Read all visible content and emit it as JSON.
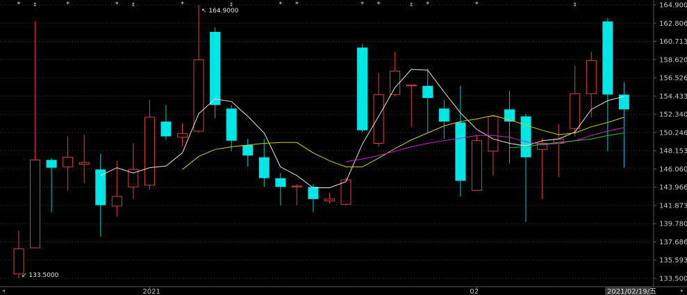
{
  "chart_data": {
    "type": "candlestick",
    "yticks": [
      "164.9000",
      "162.8067",
      "160.7133",
      "158.6200",
      "156.5267",
      "154.4333",
      "152.3400",
      "150.2467",
      "148.1533",
      "146.0600",
      "143.9667",
      "141.8733",
      "139.7800",
      "137.6867",
      "135.5933",
      "133.5000"
    ],
    "ylim": [
      133.5,
      164.9
    ],
    "x_labels": [
      {
        "index": 8,
        "text": "2021"
      },
      {
        "index": 28,
        "text": "02"
      }
    ],
    "cursor_date": "2021/02/19/五",
    "annotations": [
      {
        "text": "↖ 164.9000",
        "index": 11,
        "value": 164.9
      },
      {
        "text": "↙ 133.5000",
        "index": 0,
        "value": 133.5
      }
    ],
    "markers": [
      {
        "index": 0,
        "symbol": "*"
      },
      {
        "index": 1,
        "symbol": "⇕"
      },
      {
        "index": 3,
        "symbol": "*"
      },
      {
        "index": 6,
        "symbol": "*"
      },
      {
        "index": 7,
        "symbol": "⇕"
      },
      {
        "index": 10,
        "symbol": "*"
      },
      {
        "index": 13,
        "symbol": "⇕"
      },
      {
        "index": 16,
        "symbol": "*"
      },
      {
        "index": 17,
        "symbol": "*"
      },
      {
        "index": 21,
        "symbol": "*"
      },
      {
        "index": 22,
        "symbol": "*"
      },
      {
        "index": 24,
        "symbol": "⇕"
      },
      {
        "index": 25,
        "symbol": "*"
      },
      {
        "index": 28,
        "symbol": "*"
      },
      {
        "index": 34,
        "symbol": "⇕"
      }
    ],
    "candles": [
      {
        "o": 134.0,
        "h": 139.0,
        "l": 133.5,
        "c": 136.9
      },
      {
        "o": 137.0,
        "h": 163.0,
        "l": 137.0,
        "c": 147.1
      },
      {
        "o": 147.1,
        "h": 147.3,
        "l": 141.1,
        "c": 146.2
      },
      {
        "o": 146.3,
        "h": 149.8,
        "l": 143.6,
        "c": 147.4
      },
      {
        "o": 146.6,
        "h": 150.0,
        "l": 144.4,
        "c": 146.8
      },
      {
        "o": 146.0,
        "h": 147.8,
        "l": 138.3,
        "c": 141.9
      },
      {
        "o": 141.8,
        "h": 147.0,
        "l": 140.6,
        "c": 142.9
      },
      {
        "o": 144.0,
        "h": 149.0,
        "l": 142.6,
        "c": 146.0
      },
      {
        "o": 144.2,
        "h": 154.0,
        "l": 143.7,
        "c": 152.0
      },
      {
        "o": 151.5,
        "h": 153.4,
        "l": 149.4,
        "c": 149.8
      },
      {
        "o": 149.7,
        "h": 151.3,
        "l": 148.7,
        "c": 150.1
      },
      {
        "o": 150.4,
        "h": 164.9,
        "l": 150.2,
        "c": 158.6
      },
      {
        "o": 161.8,
        "h": 162.3,
        "l": 151.9,
        "c": 153.4
      },
      {
        "o": 153.0,
        "h": 153.4,
        "l": 148.1,
        "c": 149.3
      },
      {
        "o": 148.8,
        "h": 149.5,
        "l": 146.3,
        "c": 147.6
      },
      {
        "o": 147.4,
        "h": 149.5,
        "l": 144.0,
        "c": 145.0
      },
      {
        "o": 145.0,
        "h": 145.6,
        "l": 141.9,
        "c": 144.0
      },
      {
        "o": 144.0,
        "h": 144.3,
        "l": 141.9,
        "c": 144.1
      },
      {
        "o": 144.0,
        "h": 144.3,
        "l": 141.1,
        "c": 142.6
      },
      {
        "o": 142.4,
        "h": 143.3,
        "l": 142.1,
        "c": 142.6
      },
      {
        "o": 142.0,
        "h": 145.1,
        "l": 141.9,
        "c": 144.8
      },
      {
        "o": 160.0,
        "h": 160.4,
        "l": 150.3,
        "c": 150.5
      },
      {
        "o": 149.0,
        "h": 157.1,
        "l": 148.6,
        "c": 154.6
      },
      {
        "o": 154.6,
        "h": 159.5,
        "l": 154.4,
        "c": 157.3
      },
      {
        "o": 155.6,
        "h": 155.7,
        "l": 150.9,
        "c": 155.7
      },
      {
        "o": 155.6,
        "h": 157.6,
        "l": 150.2,
        "c": 154.2
      },
      {
        "o": 153.0,
        "h": 154.0,
        "l": 149.5,
        "c": 151.5
      },
      {
        "o": 151.4,
        "h": 155.6,
        "l": 142.9,
        "c": 144.7
      },
      {
        "o": 143.6,
        "h": 150.0,
        "l": 143.6,
        "c": 149.3
      },
      {
        "o": 148.1,
        "h": 152.2,
        "l": 145.3,
        "c": 152.1
      },
      {
        "o": 152.9,
        "h": 155.0,
        "l": 146.7,
        "c": 151.5
      },
      {
        "o": 152.1,
        "h": 152.4,
        "l": 140.0,
        "c": 147.4
      },
      {
        "o": 148.3,
        "h": 149.6,
        "l": 142.6,
        "c": 149.0
      },
      {
        "o": 149.0,
        "h": 151.2,
        "l": 145.1,
        "c": 149.5
      },
      {
        "o": 150.7,
        "h": 157.9,
        "l": 149.8,
        "c": 154.7
      },
      {
        "o": 154.7,
        "h": 159.5,
        "l": 152.0,
        "c": 158.5
      },
      {
        "o": 163.0,
        "h": 163.4,
        "l": 148.1,
        "c": 154.6
      },
      {
        "o": 154.6,
        "h": 156.0,
        "l": 146.2,
        "c": 152.9
      }
    ],
    "series": [
      {
        "color": "#e8e8e8",
        "values": [
          null,
          null,
          null,
          null,
          null,
          145.3,
          146.2,
          145.6,
          146.2,
          146.4,
          147.9,
          152.4,
          154.1,
          153.8,
          152.1,
          150.2,
          146.3,
          145.3,
          143.9,
          143.9,
          144.6,
          148.9,
          152.1,
          155.4,
          157.5,
          157.4,
          154.9,
          152.5,
          150.6,
          149.5,
          149.0,
          148.7,
          149.3,
          149.5,
          150.3,
          152.9,
          153.9,
          154.4
        ]
      },
      {
        "color": "#d4d400",
        "values": [
          null,
          null,
          null,
          null,
          null,
          null,
          null,
          null,
          null,
          null,
          146.0,
          147.5,
          148.3,
          148.6,
          148.8,
          149.0,
          149.1,
          149.1,
          147.9,
          147.0,
          146.3,
          146.3,
          147.3,
          148.4,
          149.4,
          150.2,
          151.0,
          151.5,
          151.8,
          152.2,
          151.7,
          151.1,
          150.5,
          150.0,
          150.2,
          150.9,
          151.4,
          152.0
        ]
      },
      {
        "color": "#d020d0",
        "values": [
          null,
          null,
          null,
          null,
          null,
          null,
          null,
          null,
          null,
          null,
          null,
          null,
          null,
          null,
          null,
          null,
          null,
          null,
          null,
          null,
          146.9,
          147.2,
          147.6,
          148.1,
          148.6,
          149.0,
          149.3,
          149.6,
          149.9,
          149.9,
          149.7,
          149.2,
          148.8,
          149.0,
          149.3,
          149.9,
          150.4,
          150.8
        ]
      },
      {
        "color": "#30c030",
        "values": [
          null,
          null,
          null,
          null,
          null,
          null,
          null,
          null,
          null,
          null,
          null,
          null,
          null,
          null,
          null,
          null,
          null,
          null,
          null,
          null,
          null,
          null,
          null,
          null,
          null,
          null,
          null,
          null,
          null,
          null,
          148.5,
          148.6,
          148.9,
          149.1,
          149.3,
          149.5,
          149.9,
          150.2
        ]
      }
    ]
  }
}
